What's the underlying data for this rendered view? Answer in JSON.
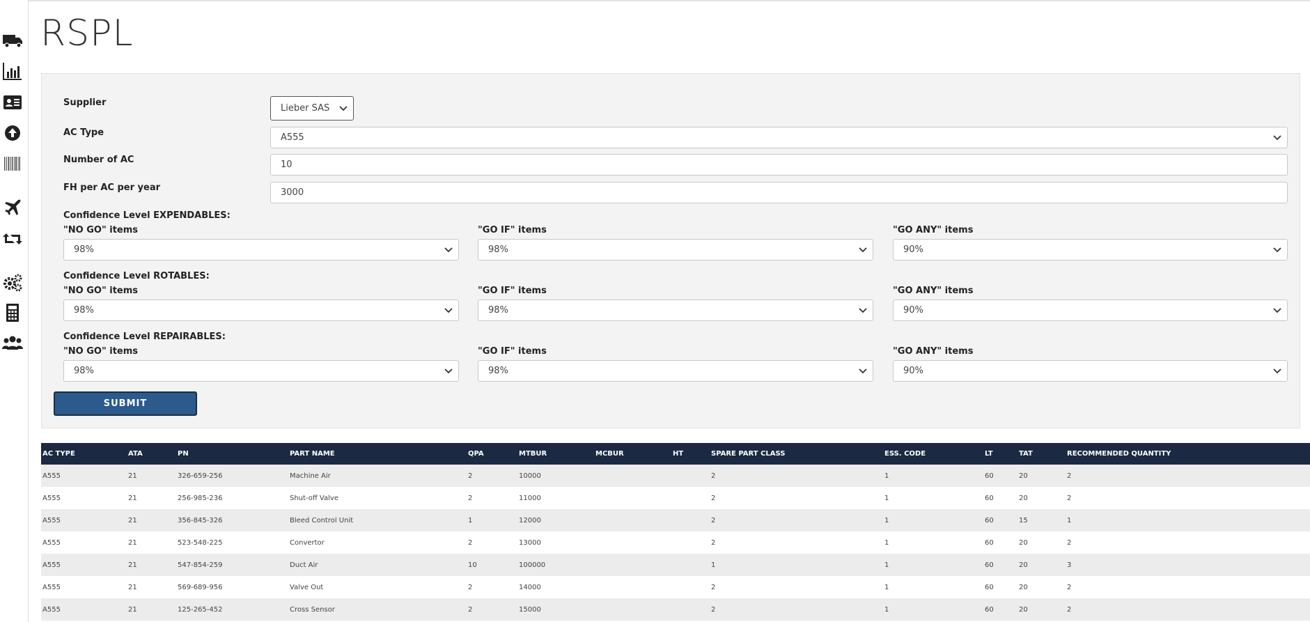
{
  "page_title": "RSPL",
  "sidebar": {
    "items": [
      {
        "icon": "truck-icon"
      },
      {
        "icon": "bar-chart-icon"
      },
      {
        "icon": "id-card-icon"
      },
      {
        "icon": "upload-circle-icon"
      },
      {
        "icon": "barcode-icon"
      },
      {
        "icon": "plane-icon"
      },
      {
        "icon": "retweet-icon"
      },
      {
        "icon": "gears-icon"
      },
      {
        "icon": "calculator-icon"
      },
      {
        "icon": "users-icon"
      }
    ]
  },
  "form": {
    "supplier": {
      "label": "Supplier",
      "value": "Lieber SAS"
    },
    "ac_type": {
      "label": "AC Type",
      "value": "A555"
    },
    "num_ac": {
      "label": "Number of AC",
      "value": "10"
    },
    "fh_per_ac": {
      "label": "FH per AC per year",
      "value": "3000"
    },
    "groups": [
      {
        "label": "Confidence Level EXPENDABLES:",
        "no_go": {
          "label": "\"NO GO\" items",
          "value": "98%"
        },
        "go_if": {
          "label": "\"GO IF\" items",
          "value": "98%"
        },
        "go_any": {
          "label": "\"GO ANY\" items",
          "value": "90%"
        }
      },
      {
        "label": "Confidence Level ROTABLES:",
        "no_go": {
          "label": "\"NO GO\" items",
          "value": "98%"
        },
        "go_if": {
          "label": "\"GO IF\" items",
          "value": "98%"
        },
        "go_any": {
          "label": "\"GO ANY\" items",
          "value": "90%"
        }
      },
      {
        "label": "Confidence Level REPAIRABLES:",
        "no_go": {
          "label": "\"NO GO\" items",
          "value": "98%"
        },
        "go_if": {
          "label": "\"GO IF\" items",
          "value": "98%"
        },
        "go_any": {
          "label": "\"GO ANY\" items",
          "value": "90%"
        }
      }
    ],
    "submit_label": "SUBMIT"
  },
  "table": {
    "headers": [
      "AC TYPE",
      "ATA",
      "PN",
      "PART NAME",
      "QPA",
      "MTBUR",
      "MCBUR",
      "HT",
      "SPARE PART CLASS",
      "ESS. CODE",
      "LT",
      "TAT",
      "RECOMMENDED QUANTITY"
    ],
    "rows": [
      [
        "A555",
        "21",
        "326-659-256",
        "Machine Air",
        "2",
        "10000",
        "",
        "",
        "2",
        "1",
        "60",
        "20",
        "2"
      ],
      [
        "A555",
        "21",
        "256-985-236",
        "Shut-off Valve",
        "2",
        "11000",
        "",
        "",
        "2",
        "1",
        "60",
        "20",
        "2"
      ],
      [
        "A555",
        "21",
        "356-845-326",
        "Bleed Control Unit",
        "1",
        "12000",
        "",
        "",
        "2",
        "1",
        "60",
        "15",
        "1"
      ],
      [
        "A555",
        "21",
        "523-548-225",
        "Convertor",
        "2",
        "13000",
        "",
        "",
        "2",
        "1",
        "60",
        "20",
        "2"
      ],
      [
        "A555",
        "21",
        "547-854-259",
        "Duct Air",
        "10",
        "100000",
        "",
        "",
        "1",
        "1",
        "60",
        "20",
        "3"
      ],
      [
        "A555",
        "21",
        "569-689-956",
        "Valve Out",
        "2",
        "14000",
        "",
        "",
        "2",
        "1",
        "60",
        "20",
        "2"
      ],
      [
        "A555",
        "21",
        "125-265-452",
        "Cross Sensor",
        "2",
        "15000",
        "",
        "",
        "2",
        "1",
        "60",
        "20",
        "2"
      ]
    ]
  }
}
